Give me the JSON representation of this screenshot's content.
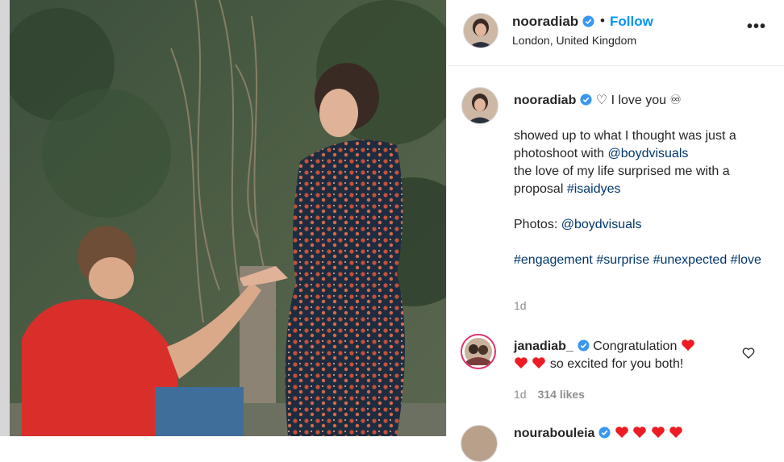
{
  "post": {
    "username": "nooradiab",
    "follow_label": "Follow",
    "separator": "•",
    "location": "London, United Kingdom",
    "more_label": "•••"
  },
  "caption": {
    "username": "nooradiab",
    "line1": "♡ I love you ♾",
    "para1_text": "showed up to what I thought was just a photoshoot with ",
    "para1_mention": "@boydvisuals",
    "para2_text": "the love of my life surprised me with a proposal ",
    "para2_hashtag": "#isaidyes",
    "photos_label": "Photos: ",
    "photos_mention": "@boydvisuals",
    "hashtags": [
      "#engagement",
      "#surprise",
      "#unexpected",
      "#love"
    ],
    "time": "1d"
  },
  "comments": [
    {
      "username": "janadiab_",
      "text_before": "Congratulation",
      "text_after": "so excited for you both!",
      "time": "1d",
      "likes": "314 likes"
    },
    {
      "username": "nourabouleia"
    }
  ],
  "colors": {
    "accent": "#0095f6",
    "link": "#00376b",
    "heart": "#ed1c24",
    "meta": "#8e8e8e"
  },
  "icons": {
    "verified": "verified-badge-icon",
    "like": "heart-outline-icon",
    "more": "more-options-icon"
  }
}
